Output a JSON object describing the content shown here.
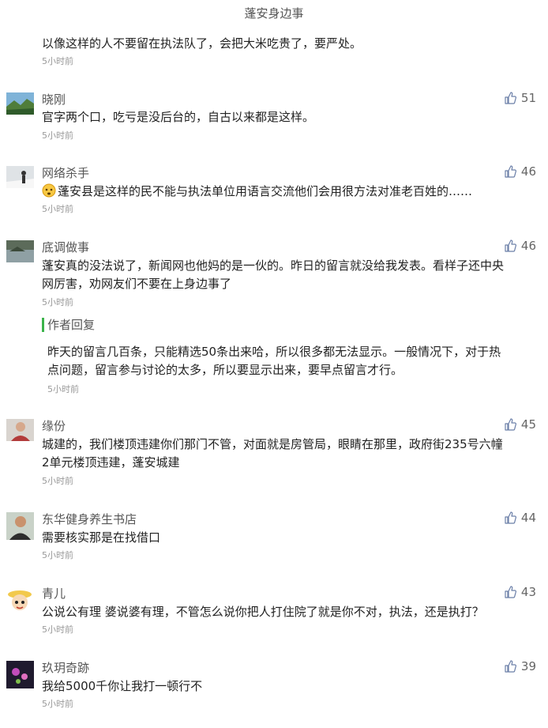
{
  "page": {
    "title": "蓬安身边事"
  },
  "top_comment": {
    "text": "以像这样的人不要留在执法队了，会把大米吃贵了，要严处。",
    "time": "5小时前"
  },
  "comments": [
    {
      "nickname": "晓刚",
      "likes": "51",
      "text": "官字两个口，吃亏是没后台的，自古以来都是这样。",
      "time": "5小时前",
      "avatar_icon": "landscape-avatar-icon"
    },
    {
      "nickname": "网络杀手",
      "likes": "46",
      "text": "蓬安县是这样的民不能与执法单位用语言交流他们会用很方法对准老百姓的……",
      "time": "5小时前",
      "avatar_icon": "snow-figure-avatar-icon",
      "emoji_icon": "worried-face-emoji-icon"
    },
    {
      "nickname": "底调做事",
      "likes": "46",
      "text_line1": "蓬安真的没法说了，新闻网也他妈的是一伙的。昨日的留言就没给我发表。看样子还中央",
      "text_line2": "网厉害，劝网友们不要在上身边事了",
      "time": "5小时前",
      "avatar_icon": "lake-avatar-icon"
    },
    {
      "nickname": "缘份",
      "likes": "45",
      "text_line1": "城建的，我们楼顶违建你们那门不管，对面就是房管局，眼睛在那里，政府街235号六幢",
      "text_line2": "2单元楼顶违建，蓬安城建",
      "time": "5小时前",
      "avatar_icon": "portrait-avatar-icon"
    },
    {
      "nickname": "东华健身养生书店",
      "likes": "44",
      "text": "需要核实那是在找借口",
      "time": "5小时前",
      "avatar_icon": "man-portrait-avatar-icon"
    },
    {
      "nickname": "青儿",
      "likes": "43",
      "text": "公说公有理 婆说婆有理，不管怎么说你把人打住院了就是你不对，执法，还是执打？",
      "time": "5小时前",
      "avatar_icon": "cartoon-avatar-icon"
    },
    {
      "nickname": "玖玥奇跡",
      "likes": "39",
      "text": "我给5000千你让我打一顿行不",
      "time": "5小时前",
      "avatar_icon": "flower-avatar-icon"
    }
  ],
  "author_reply": {
    "label": "作者回复",
    "text_line1": "昨天的留言几百条，只能精选50条出来哈，所以很多都无法显示。一般情况下，对于热",
    "text_line2": "点问题，留言参与讨论的太多，所以要显示出来，要早点留言才行。",
    "time": "5小时前"
  },
  "colors": {
    "reply_bar": "#3bb34a",
    "like_icon": "#6b7fa8"
  }
}
